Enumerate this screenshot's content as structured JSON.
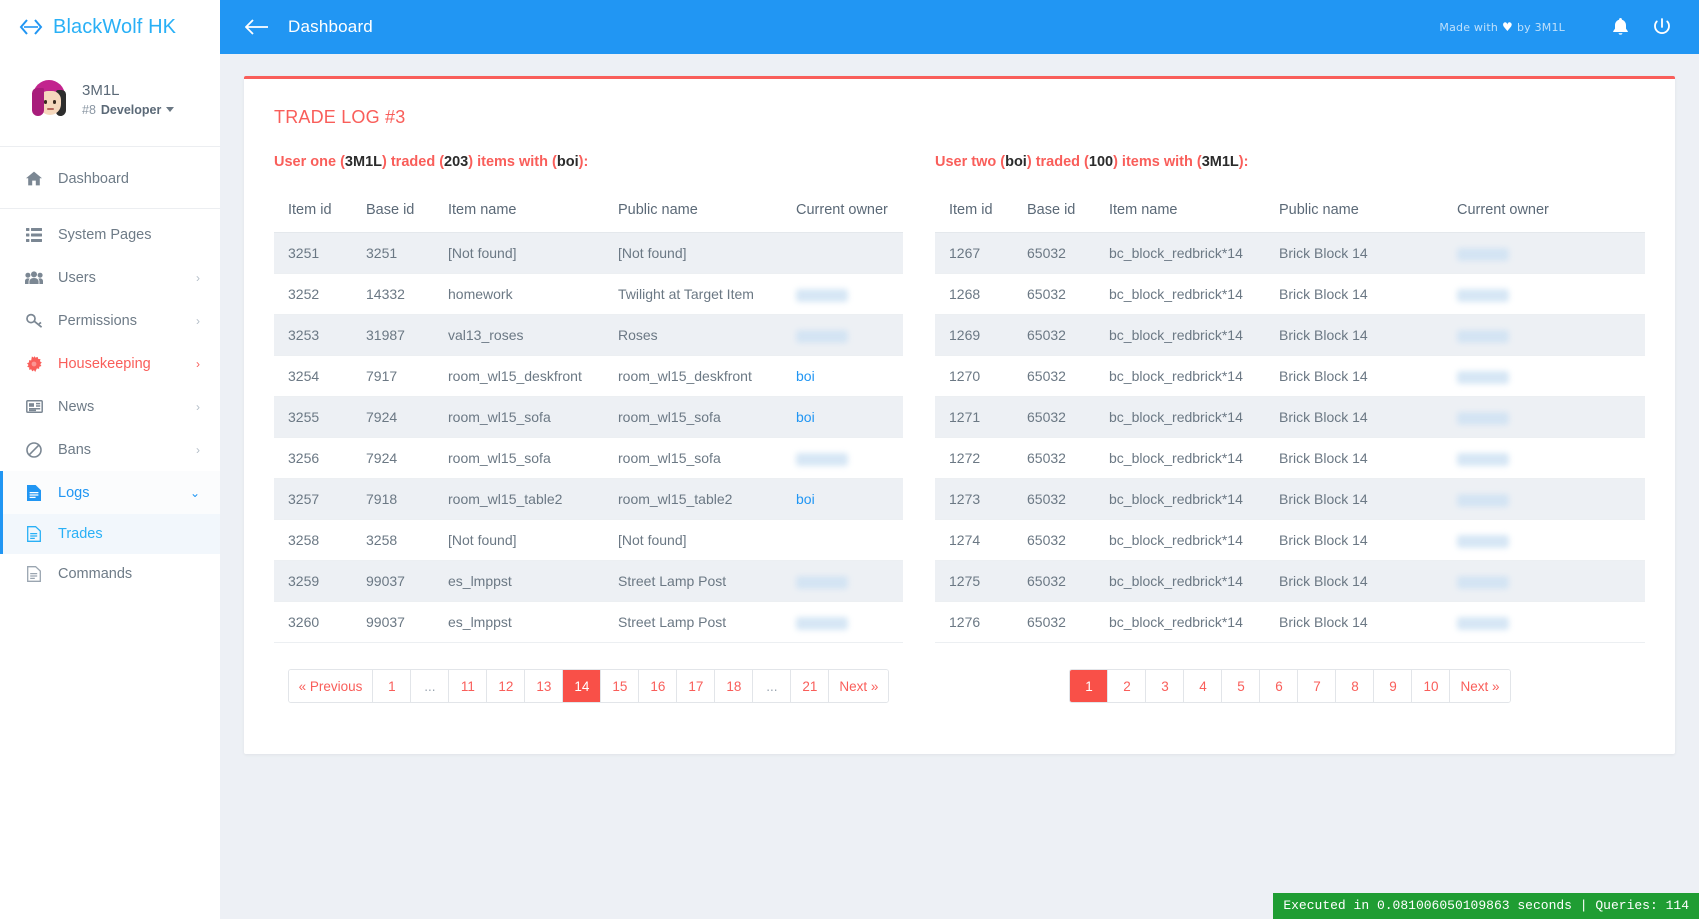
{
  "brand": {
    "name": "BlackWolf HK",
    "logo_icon": "chevrons-logo-icon"
  },
  "profile": {
    "name": "3M1L",
    "rank_prefix": "#8",
    "rank": "Developer",
    "avatar_icon": "user-avatar"
  },
  "sidebar": {
    "items": [
      {
        "label": "Dashboard",
        "icon": "home-icon",
        "arrow": "",
        "state": "normal"
      },
      {
        "label": "System Pages",
        "icon": "list-icon",
        "arrow": "",
        "state": "normal"
      },
      {
        "label": "Users",
        "icon": "users-icon",
        "arrow": "›",
        "state": "normal"
      },
      {
        "label": "Permissions",
        "icon": "key-icon",
        "arrow": "›",
        "state": "normal"
      },
      {
        "label": "Housekeeping",
        "icon": "gear-icon",
        "arrow": "›",
        "state": "danger"
      },
      {
        "label": "News",
        "icon": "newspaper-icon",
        "arrow": "›",
        "state": "normal"
      },
      {
        "label": "Bans",
        "icon": "ban-icon",
        "arrow": "›",
        "state": "normal"
      },
      {
        "label": "Logs",
        "icon": "file-text-icon",
        "arrow": "⌄",
        "state": "active-parent"
      }
    ],
    "sub_items": [
      {
        "label": "Trades",
        "icon": "file-icon",
        "state": "current"
      },
      {
        "label": "Commands",
        "icon": "file-icon",
        "state": "normal"
      }
    ]
  },
  "topbar": {
    "back_icon": "back-arrow-icon",
    "title": "Dashboard",
    "made_with_prefix": "Made with",
    "made_with_heart": "♥",
    "made_with_suffix": "by 3M1L",
    "bell_icon": "bell-icon",
    "power_icon": "power-icon"
  },
  "card": {
    "title": "TRADE LOG #3",
    "accent_color": "#f95e5a"
  },
  "left_table": {
    "heading_parts": [
      {
        "text": "User one (",
        "bold": false
      },
      {
        "text": "3M1L",
        "bold": true
      },
      {
        "text": ") traded (",
        "bold": false
      },
      {
        "text": "203",
        "bold": true
      },
      {
        "text": ") items with (",
        "bold": false
      },
      {
        "text": "boi",
        "bold": true
      },
      {
        "text": "):",
        "bold": false
      }
    ],
    "columns": [
      "Item id",
      "Base id",
      "Item name",
      "Public name",
      "Current owner"
    ],
    "rows": [
      {
        "item_id": "3251",
        "base_id": "3251",
        "item_name": "[Not found]",
        "public_name": "[Not found]",
        "owner": "",
        "owner_type": "empty"
      },
      {
        "item_id": "3252",
        "base_id": "14332",
        "item_name": "homework",
        "public_name": "Twilight at Target Item",
        "owner": "",
        "owner_type": "redacted"
      },
      {
        "item_id": "3253",
        "base_id": "31987",
        "item_name": "val13_roses",
        "public_name": "Roses",
        "owner": "",
        "owner_type": "redacted"
      },
      {
        "item_id": "3254",
        "base_id": "7917",
        "item_name": "room_wl15_deskfront",
        "public_name": "room_wl15_deskfront",
        "owner": "boi",
        "owner_type": "link"
      },
      {
        "item_id": "3255",
        "base_id": "7924",
        "item_name": "room_wl15_sofa",
        "public_name": "room_wl15_sofa",
        "owner": "boi",
        "owner_type": "link"
      },
      {
        "item_id": "3256",
        "base_id": "7924",
        "item_name": "room_wl15_sofa",
        "public_name": "room_wl15_sofa",
        "owner": "",
        "owner_type": "redacted"
      },
      {
        "item_id": "3257",
        "base_id": "7918",
        "item_name": "room_wl15_table2",
        "public_name": "room_wl15_table2",
        "owner": "boi",
        "owner_type": "link"
      },
      {
        "item_id": "3258",
        "base_id": "3258",
        "item_name": "[Not found]",
        "public_name": "[Not found]",
        "owner": "",
        "owner_type": "empty"
      },
      {
        "item_id": "3259",
        "base_id": "99037",
        "item_name": "es_lmppst",
        "public_name": "Street Lamp Post",
        "owner": "",
        "owner_type": "redacted"
      },
      {
        "item_id": "3260",
        "base_id": "99037",
        "item_name": "es_lmppst",
        "public_name": "Street Lamp Post",
        "owner": "",
        "owner_type": "redacted"
      }
    ],
    "pagination": {
      "pages": [
        "« Previous",
        "1",
        "...",
        "11",
        "12",
        "13",
        "14",
        "15",
        "16",
        "17",
        "18",
        "...",
        "21",
        "Next »"
      ],
      "active": "14"
    }
  },
  "right_table": {
    "heading_parts": [
      {
        "text": "User two (",
        "bold": false
      },
      {
        "text": "boi",
        "bold": true
      },
      {
        "text": ") traded (",
        "bold": false
      },
      {
        "text": "100",
        "bold": true
      },
      {
        "text": ") items with (",
        "bold": false
      },
      {
        "text": "3M1L",
        "bold": true
      },
      {
        "text": "):",
        "bold": false
      }
    ],
    "columns": [
      "Item id",
      "Base id",
      "Item name",
      "Public name",
      "Current owner"
    ],
    "rows": [
      {
        "item_id": "1267",
        "base_id": "65032",
        "item_name": "bc_block_redbrick*14",
        "public_name": "Brick Block 14",
        "owner": "",
        "owner_type": "redacted"
      },
      {
        "item_id": "1268",
        "base_id": "65032",
        "item_name": "bc_block_redbrick*14",
        "public_name": "Brick Block 14",
        "owner": "",
        "owner_type": "redacted"
      },
      {
        "item_id": "1269",
        "base_id": "65032",
        "item_name": "bc_block_redbrick*14",
        "public_name": "Brick Block 14",
        "owner": "",
        "owner_type": "redacted"
      },
      {
        "item_id": "1270",
        "base_id": "65032",
        "item_name": "bc_block_redbrick*14",
        "public_name": "Brick Block 14",
        "owner": "",
        "owner_type": "redacted"
      },
      {
        "item_id": "1271",
        "base_id": "65032",
        "item_name": "bc_block_redbrick*14",
        "public_name": "Brick Block 14",
        "owner": "",
        "owner_type": "redacted"
      },
      {
        "item_id": "1272",
        "base_id": "65032",
        "item_name": "bc_block_redbrick*14",
        "public_name": "Brick Block 14",
        "owner": "",
        "owner_type": "redacted"
      },
      {
        "item_id": "1273",
        "base_id": "65032",
        "item_name": "bc_block_redbrick*14",
        "public_name": "Brick Block 14",
        "owner": "",
        "owner_type": "redacted"
      },
      {
        "item_id": "1274",
        "base_id": "65032",
        "item_name": "bc_block_redbrick*14",
        "public_name": "Brick Block 14",
        "owner": "",
        "owner_type": "redacted"
      },
      {
        "item_id": "1275",
        "base_id": "65032",
        "item_name": "bc_block_redbrick*14",
        "public_name": "Brick Block 14",
        "owner": "",
        "owner_type": "redacted"
      },
      {
        "item_id": "1276",
        "base_id": "65032",
        "item_name": "bc_block_redbrick*14",
        "public_name": "Brick Block 14",
        "owner": "",
        "owner_type": "redacted"
      }
    ],
    "pagination": {
      "pages": [
        "1",
        "2",
        "3",
        "4",
        "5",
        "6",
        "7",
        "8",
        "9",
        "10",
        "Next »"
      ],
      "active": "1"
    }
  },
  "statusbar": {
    "text": "Executed in 0.081006050109863 seconds | Queries: 114"
  }
}
